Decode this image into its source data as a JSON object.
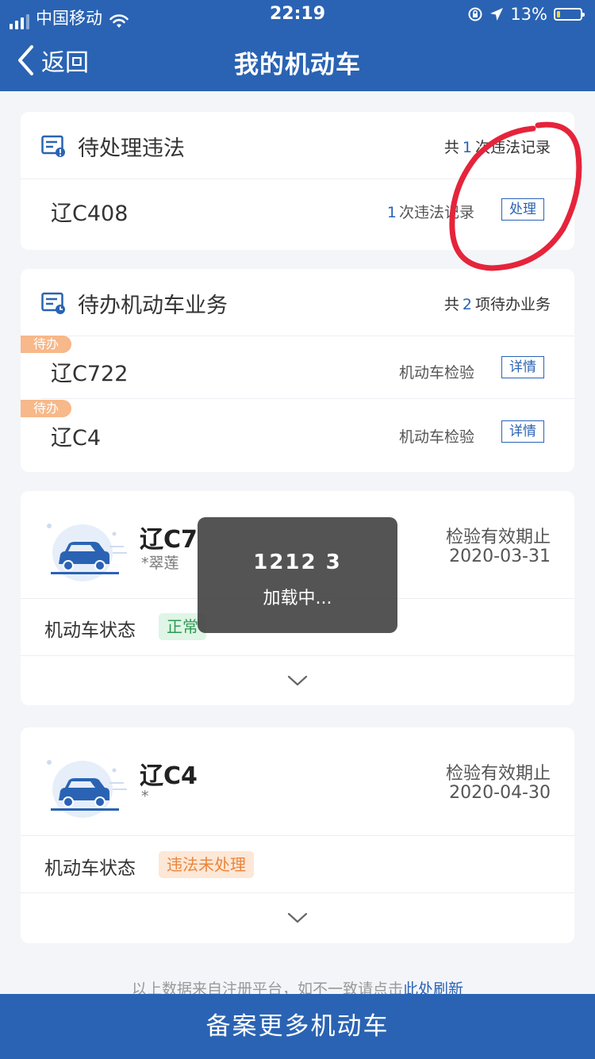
{
  "status_bar": {
    "carrier": "中国移动",
    "time": "22:19",
    "battery": "13%",
    "icons": [
      "signal-icon",
      "wifi-icon",
      "rotation-lock-icon",
      "location-icon",
      "battery-icon"
    ]
  },
  "nav": {
    "back_label": "返回",
    "title": "我的机动车"
  },
  "violations": {
    "title": "待处理违法",
    "count_prefix": "共",
    "count": "1",
    "count_suffix": "次违法记录",
    "items": [
      {
        "plate": "辽C408",
        "count": "1",
        "count_suffix": "次违法记录",
        "action": "处理"
      }
    ]
  },
  "pending": {
    "title": "待办机动车业务",
    "count_prefix": "共",
    "count": "2",
    "count_suffix": "项待办业务",
    "items": [
      {
        "tag": "待办",
        "plate": "辽C722",
        "service": "机动车检验",
        "action": "详情"
      },
      {
        "tag": "待办",
        "plate": "辽C4",
        "service": "机动车检验",
        "action": "详情"
      }
    ]
  },
  "vehicles": [
    {
      "plate": "辽C7",
      "owner": "*翠莲",
      "expiry_label": "检验有效期止",
      "expiry_date": "2020-03-31",
      "state_label": "机动车状态",
      "state": "正常"
    },
    {
      "plate": "辽C4",
      "owner": "*",
      "expiry_label": "检验有效期止",
      "expiry_date": "2020-04-30",
      "state_label": "机动车状态",
      "state": "违法未处理"
    }
  ],
  "footnote": {
    "text": "以上数据来自注册平台，如不一致请点击",
    "link": "此处刷新"
  },
  "bottom_button": "备案更多机动车",
  "toast": {
    "line1": "1212 3",
    "line2": "加载中..."
  },
  "colors": {
    "primary": "#2a63b3",
    "background": "#f3f5f9",
    "pending_tag": "#f7b88a",
    "ok_badge": "#2f9a52",
    "warn_badge": "#e9853d",
    "annotation": "#e5243b"
  }
}
